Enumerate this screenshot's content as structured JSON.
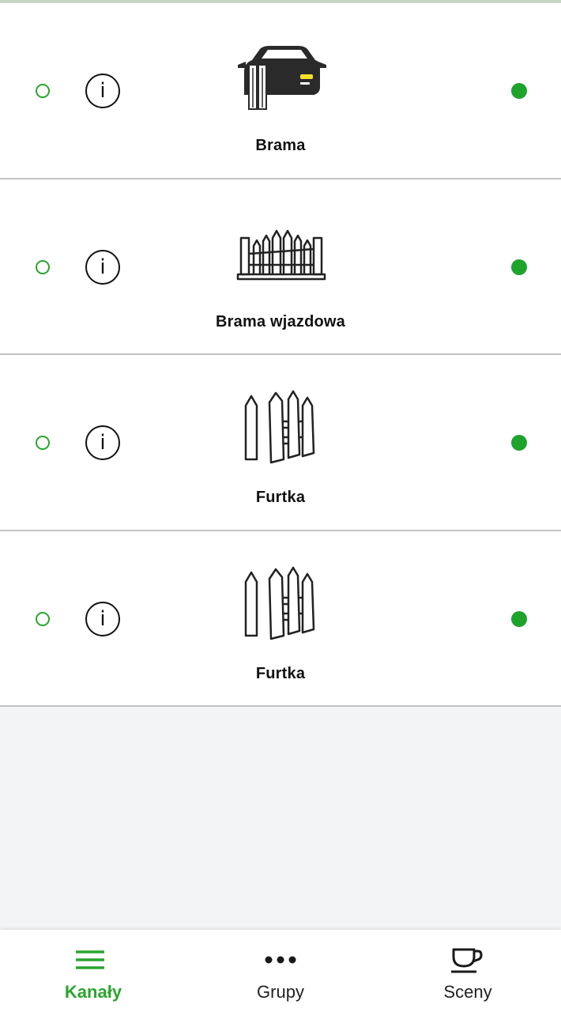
{
  "channels": [
    {
      "label": "Brama",
      "icon": "car-gate-icon"
    },
    {
      "label": "Brama wjazdowa",
      "icon": "driveway-gate-icon"
    },
    {
      "label": "Furtka",
      "icon": "wicket-gate-icon"
    },
    {
      "label": "Furtka",
      "icon": "wicket-gate-icon"
    }
  ],
  "nav": {
    "channels_label": "Kanały",
    "groups_label": "Grupy",
    "scenes_label": "Sceny"
  },
  "colors": {
    "accent": "#2aa52e",
    "connected": "#1ea32d",
    "background": "#f3f4f6"
  }
}
